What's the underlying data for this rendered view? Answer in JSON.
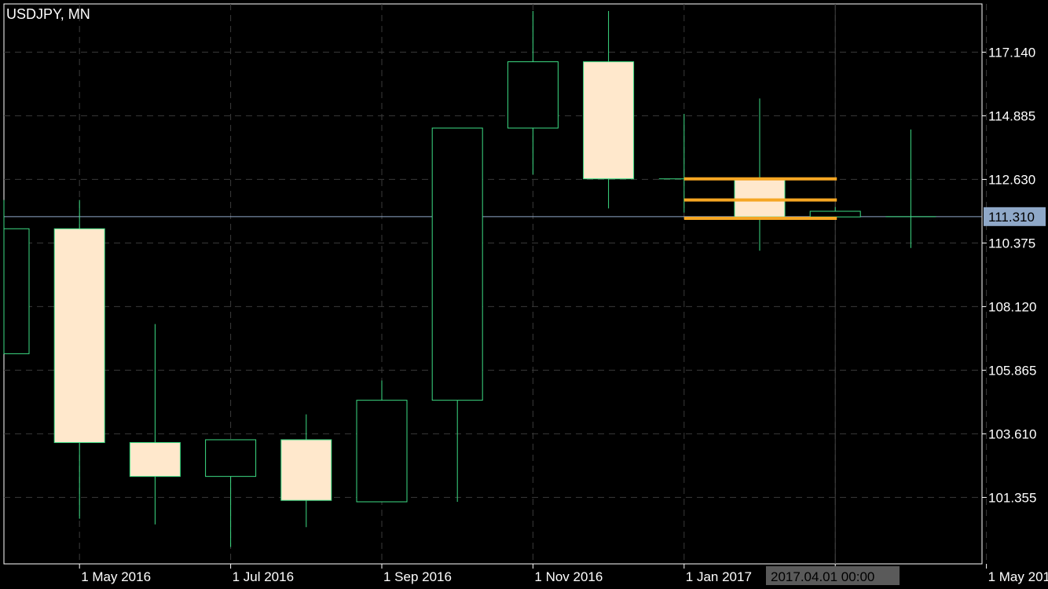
{
  "header": {
    "title": "USDJPY, MN"
  },
  "cursor": {
    "time_label": "2017.04.01 00:00",
    "price_label": "111.310"
  },
  "chart_data": {
    "type": "candlestick",
    "symbol": "USDJPY",
    "timeframe": "MN",
    "ylim": [
      99.0,
      118.85
    ],
    "y_ticks": [
      "117.140",
      "114.885",
      "112.630",
      "110.375",
      "108.120",
      "105.865",
      "103.610",
      "101.355"
    ],
    "x_ticks": [
      "1 May 2016",
      "1 Jul 2016",
      "1 Sep 2016",
      "1 Nov 2016",
      "1 Jan 2017",
      "1",
      "1 May 2017"
    ],
    "current_price": 111.31,
    "grid": true,
    "colors": {
      "background": "#000000",
      "grid": "#3a3a3a",
      "bull_outline": "#3ddc84",
      "bear_fill": "#ffe8cc",
      "bear_outline": "#3ddc84",
      "price_line": "#8fa8c8",
      "annotation": "#f5a623",
      "axis_text": "#ffffff"
    },
    "candles": [
      {
        "date": "2016-04",
        "open": 106.45,
        "high": 111.9,
        "low": 106.45,
        "close": 110.88
      },
      {
        "date": "2016-05",
        "open": 110.88,
        "high": 111.9,
        "low": 100.6,
        "close": 103.3
      },
      {
        "date": "2016-06",
        "open": 103.3,
        "high": 107.5,
        "low": 100.4,
        "close": 102.1
      },
      {
        "date": "2016-07",
        "open": 102.1,
        "high": 103.3,
        "low": 99.6,
        "close": 103.4
      },
      {
        "date": "2016-08",
        "open": 103.4,
        "high": 104.3,
        "low": 100.3,
        "close": 101.25
      },
      {
        "date": "2016-09",
        "open": 101.2,
        "high": 105.5,
        "low": 101.2,
        "close": 104.8
      },
      {
        "date": "2016-10",
        "open": 104.8,
        "high": 114.2,
        "low": 101.2,
        "close": 114.45
      },
      {
        "date": "2016-11",
        "open": 114.45,
        "high": 118.6,
        "low": 112.8,
        "close": 116.8
      },
      {
        "date": "2016-12",
        "open": 116.8,
        "high": 118.6,
        "low": 111.6,
        "close": 112.65
      },
      {
        "date": "2017-01",
        "open": 112.65,
        "high": 114.95,
        "low": 111.45,
        "close": 112.65
      },
      {
        "date": "2017-02",
        "open": 112.65,
        "high": 115.5,
        "low": 110.1,
        "close": 111.3
      },
      {
        "date": "2017-03",
        "open": 111.3,
        "high": 111.65,
        "low": 111.3,
        "close": 111.5
      },
      {
        "date": "2017-04",
        "open": 111.3,
        "high": 114.4,
        "low": 110.2,
        "close": 111.31
      }
    ],
    "annotations": [
      {
        "type": "hline",
        "price": 112.65,
        "from_date": "2017-01",
        "to_date": "2017-03"
      },
      {
        "type": "hline",
        "price": 111.9,
        "from_date": "2017-01",
        "to_date": "2017-03"
      },
      {
        "type": "hline",
        "price": 111.25,
        "from_date": "2017-01",
        "to_date": "2017-03"
      }
    ]
  }
}
